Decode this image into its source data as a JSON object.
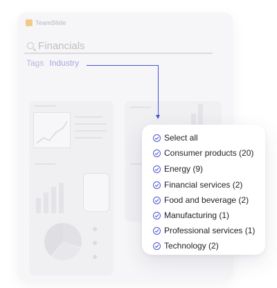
{
  "app": {
    "name": "TeamSlide"
  },
  "search": {
    "value": "Financials"
  },
  "filters": {
    "tags_label": "Tags",
    "industry_label": "Industry"
  },
  "dropdown": {
    "items": [
      {
        "label": "Select all"
      },
      {
        "label": "Consumer products (20)"
      },
      {
        "label": "Energy (9)"
      },
      {
        "label": "Financial services (2)"
      },
      {
        "label": "Food and beverage (2)"
      },
      {
        "label": "Manufacturing (1)"
      },
      {
        "label": "Professional services (1)"
      },
      {
        "label": "Technology (2)"
      }
    ]
  },
  "colors": {
    "accent": "#4a52d4",
    "logo": "#f3c98a"
  }
}
